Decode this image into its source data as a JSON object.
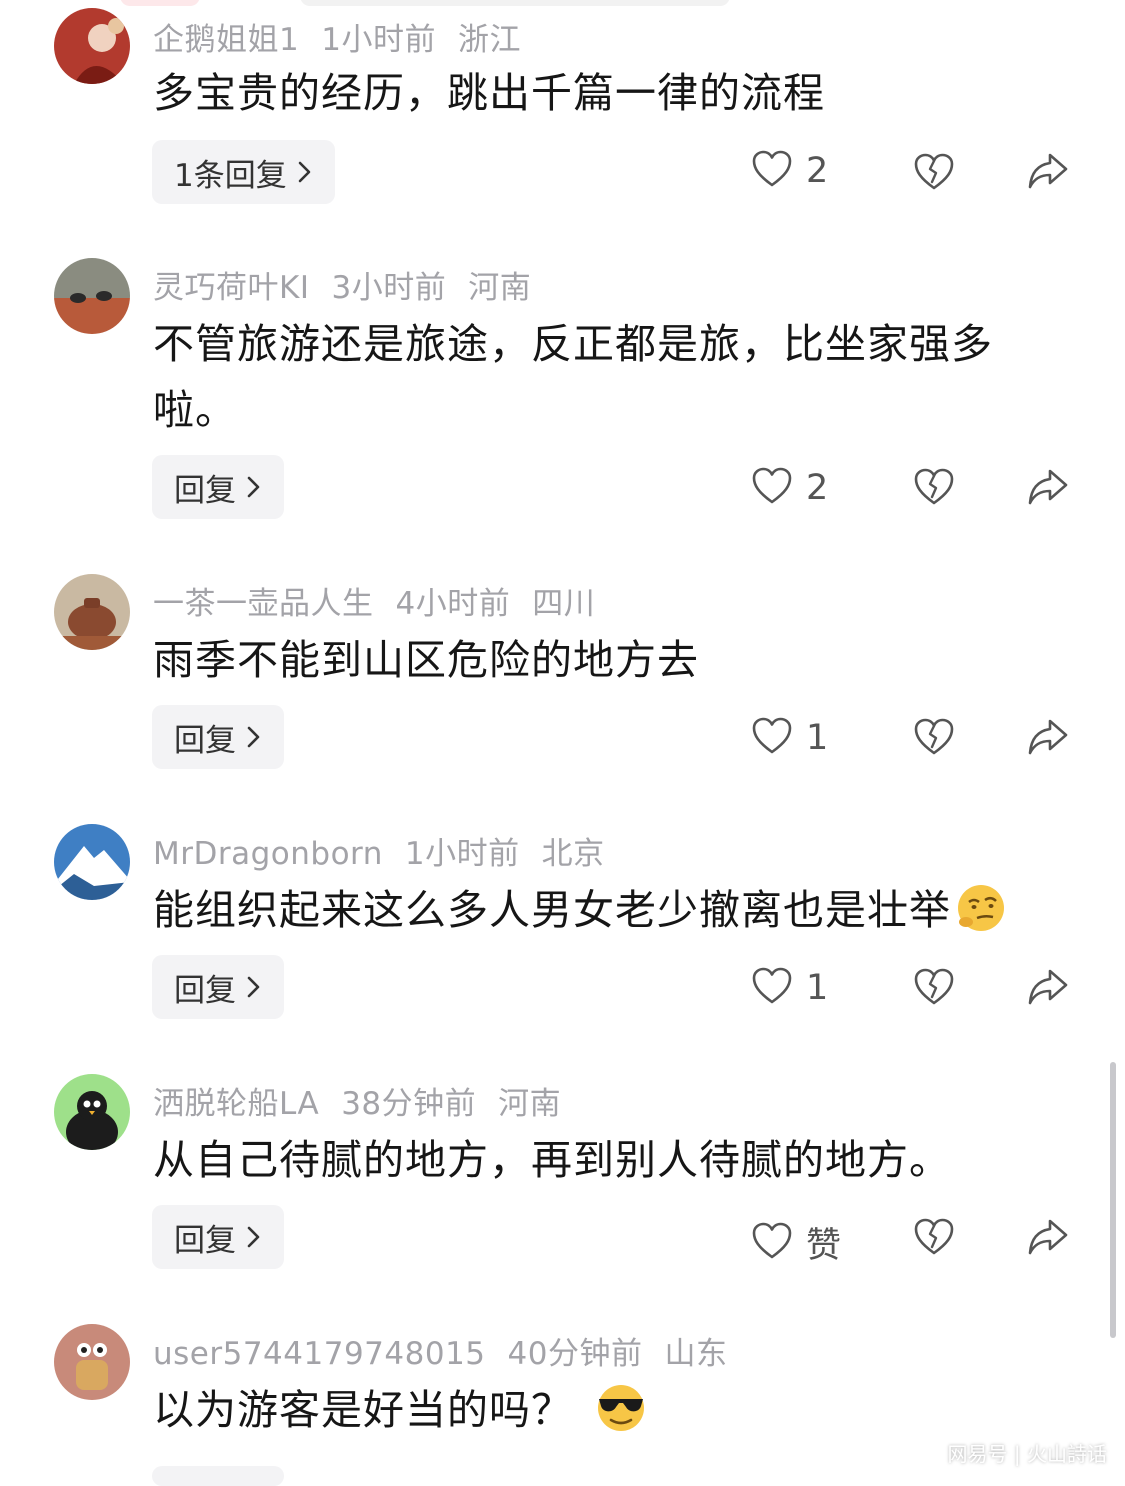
{
  "comments": [
    {
      "username": "企鹅姐姐1",
      "time": "1小时前",
      "location": "浙江",
      "text": "多宝贵的经历，跳出千篇一律的流程",
      "reply_label": "1条回复",
      "likes": "2"
    },
    {
      "username": "灵巧荷叶KI",
      "time": "3小时前",
      "location": "河南",
      "text": "不管旅游还是旅途，反正都是旅，比坐家强多啦。",
      "reply_label": "回复",
      "likes": "2"
    },
    {
      "username": "一茶一壶品人生",
      "time": "4小时前",
      "location": "四川",
      "text": "雨季不能到山区危险的地方去",
      "reply_label": "回复",
      "likes": "1"
    },
    {
      "username": "MrDragonborn",
      "time": "1小时前",
      "location": "北京",
      "text": "能组织起来这么多人男女老少撤离也是壮举",
      "reply_label": "回复",
      "likes": "1"
    },
    {
      "username": "洒脱轮船LA",
      "time": "38分钟前",
      "location": "河南",
      "text": "从自己待腻的地方，再到别人待腻的地方。",
      "reply_label": "回复",
      "likes": "赞"
    },
    {
      "username": "user5744179748015",
      "time": "40分钟前",
      "location": "山东",
      "text": "以为游客是好当的吗？"
    }
  ],
  "watermark": "网易号 | 火山詩话",
  "icons": {
    "like": "heart-outline-icon",
    "dislike": "broken-heart-icon",
    "share": "share-arrow-icon",
    "chevron": "chevron-right-icon"
  },
  "colors": {
    "meta_text": "#a3a3a8",
    "body_text": "#161616",
    "reply_bg": "#f3f3f5"
  }
}
